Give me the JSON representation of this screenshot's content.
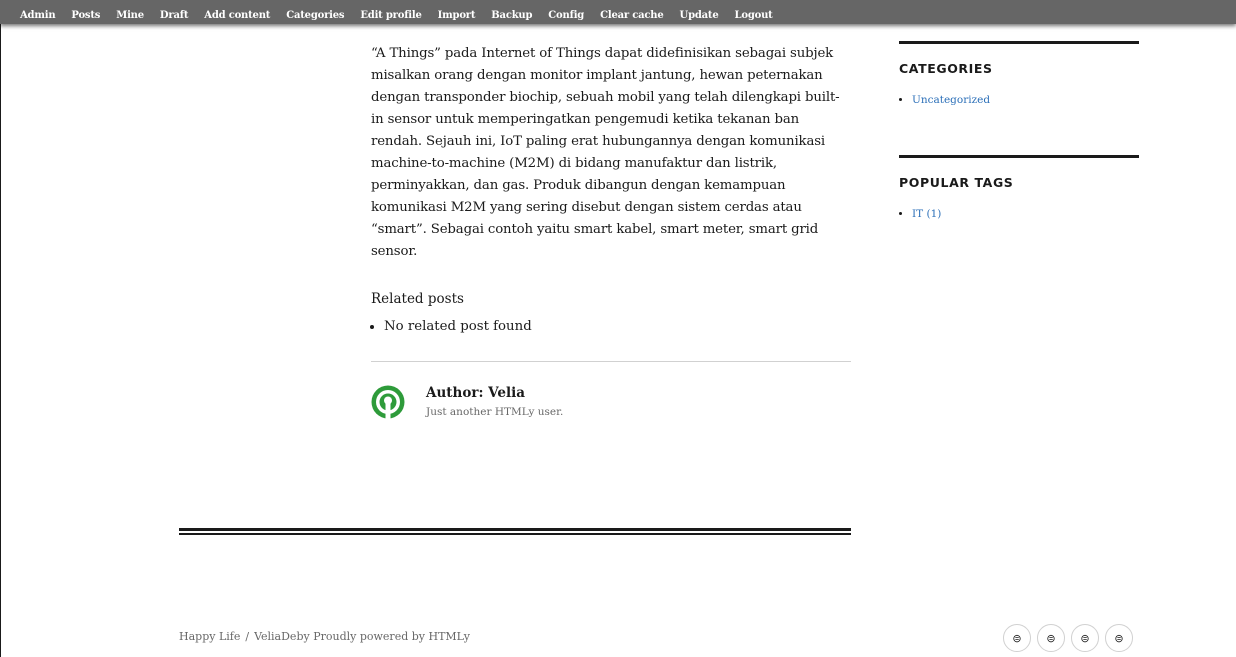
{
  "admin_bar": {
    "items": [
      "Admin",
      "Posts",
      "Mine",
      "Draft",
      "Add content",
      "Categories",
      "Edit profile",
      "Import",
      "Backup",
      "Config",
      "Clear cache",
      "Update",
      "Logout"
    ]
  },
  "article": {
    "body": "“A Things” pada Internet of Things dapat didefinisikan sebagai subjek misalkan orang dengan monitor implant jantung, hewan peternakan dengan transponder biochip, sebuah mobil yang telah dilengkapi built-in sensor untuk memperingatkan pengemudi ketika tekanan ban rendah. Sejauh ini, IoT paling erat hubungannya dengan komunikasi machine-to-machine (M2M) di bidang manufaktur dan listrik, perminyakkan, dan gas. Produk dibangun dengan kemampuan komunikasi M2M yang sering disebut dengan sistem cerdas atau “smart”. Sebagai contoh yaitu smart kabel, smart meter, smart grid sensor."
  },
  "related": {
    "title": "Related posts",
    "items": [
      "No related post found"
    ]
  },
  "author": {
    "name": "Author: Velia",
    "description": "Just another HTMLy user."
  },
  "sidebar": {
    "categories": {
      "title": "CATEGORIES",
      "items": [
        "Uncategorized"
      ]
    },
    "tags": {
      "title": "POPULAR TAGS",
      "items": [
        "IT (1)"
      ]
    }
  },
  "footer": {
    "site": "Happy Life",
    "separator": "/",
    "owner": "VeliaDeby",
    "powered": "Proudly powered by HTMLy"
  },
  "social": {
    "icons": [
      "social-icon",
      "social-icon",
      "social-icon",
      "social-icon"
    ],
    "glyph": "⊜"
  },
  "colors": {
    "admin_bar": "#666666",
    "link": "#2b6fb8",
    "avatar": "#2e9b3a"
  }
}
